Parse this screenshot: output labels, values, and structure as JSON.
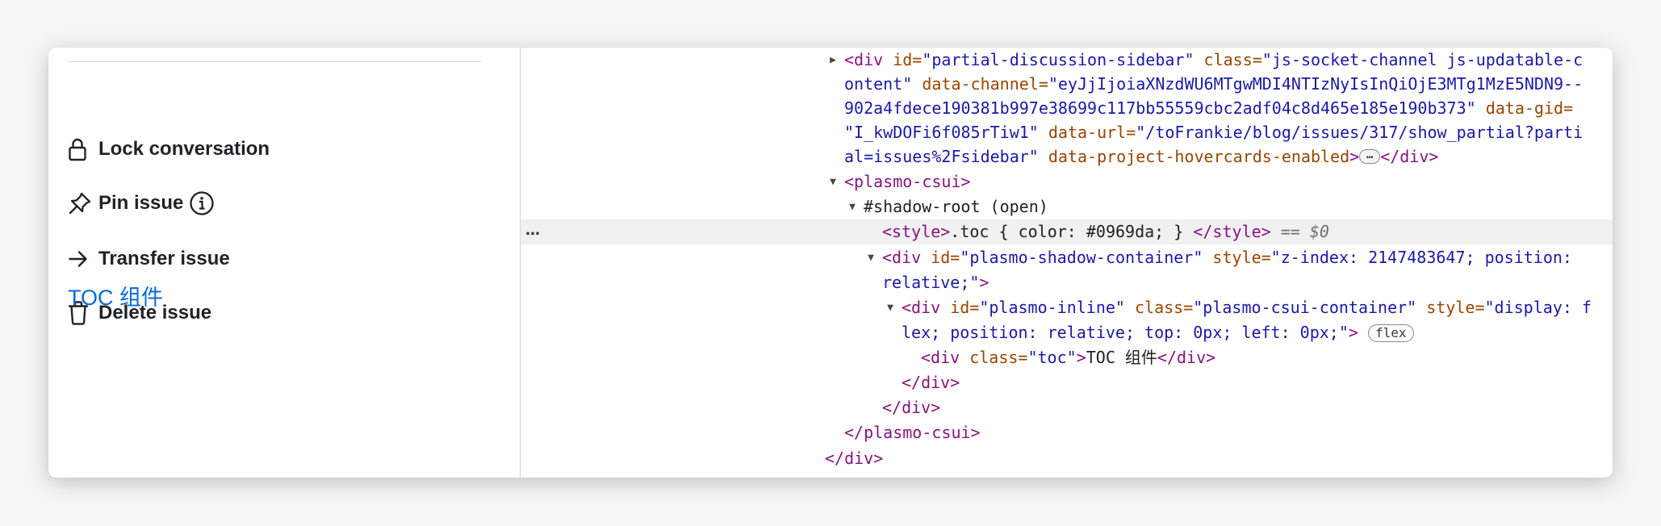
{
  "sidebar": {
    "actions": [
      {
        "label": "Lock conversation",
        "icon": "lock-icon"
      },
      {
        "label": "Pin issue",
        "icon": "pin-icon",
        "extra_icon": "info-icon"
      },
      {
        "label": "Transfer issue",
        "icon": "arrow-right-icon"
      },
      {
        "label": "Delete issue",
        "icon": "trash-icon"
      }
    ],
    "toc_text": "TOC 组件"
  },
  "elements": {
    "l1": {
      "tag_open": "<div",
      "a1": " id=",
      "v1": "\"partial-discussion-sidebar\"",
      "a2": " class=",
      "v2": "\"js-socket-channel js-updatable-c"
    },
    "l2": {
      "v2b": "ontent\"",
      "a3": " data-channel=",
      "v3": "\"eyJjIjoiaXNzdWU6MTgwMDI4NTIzNyIsInQiOjE3MTg1MzE5NDN9--"
    },
    "l3": {
      "v3b": "902a4fdece190381b997e38699c117bb55559cbc2adf04c8d465e185e190b373\"",
      "a4": " data-gid="
    },
    "l4": {
      "v4": "\"I_kwDOFi6f085rTiw1\"",
      "a5": " data-url=",
      "v5": "\"/toFrankie/blog/issues/317/show_partial?parti"
    },
    "l5": {
      "v5b": "al=issues%2Fsidebar\"",
      "a6": " data-project-hovercards-enabled",
      "close1": ">",
      "ellipsis": "…",
      "end": "</div>"
    },
    "l6": {
      "text": "<plasmo-csui>"
    },
    "l7": {
      "text": "#shadow-root (open)"
    },
    "l8": {
      "gutter": "…",
      "open": "<style>",
      "content": ".toc { color: #0969da; } ",
      "close": "</style>",
      "eq": " == ",
      "ref": "$0"
    },
    "l9": {
      "tag_open": "<div",
      "a1": " id=",
      "v1": "\"plasmo-shadow-container\"",
      "a2": " style=",
      "v2": "\"z-index: 2147483647; position:"
    },
    "l10": {
      "v2b": "relative;\"",
      "close": ">"
    },
    "l11": {
      "tag_open": "<div",
      "a1": " id=",
      "v1": "\"plasmo-inline\"",
      "a2": " class=",
      "v2": "\"plasmo-csui-container\"",
      "a3": " style=",
      "v3": "\"display: f"
    },
    "l12": {
      "v3b": "lex; position: relative; top: 0px; left: 0px;\"",
      "close": ">",
      "badge": "flex"
    },
    "l13": {
      "open": "<div",
      "a1": " class=",
      "v1": "\"toc\"",
      "close": ">",
      "content": "TOC 组件",
      "end": "</div>"
    },
    "l14": {
      "text": "</div>"
    },
    "l15": {
      "text": "</div>"
    },
    "l16": {
      "text": "</plasmo-csui>"
    },
    "l17": {
      "text": "</div>"
    }
  },
  "colors": {
    "link_blue": "#0969da",
    "tag": "#881280",
    "attr_name": "#994500",
    "attr_value": "#1a1aa6",
    "selected_row": "#f0f0f0"
  }
}
